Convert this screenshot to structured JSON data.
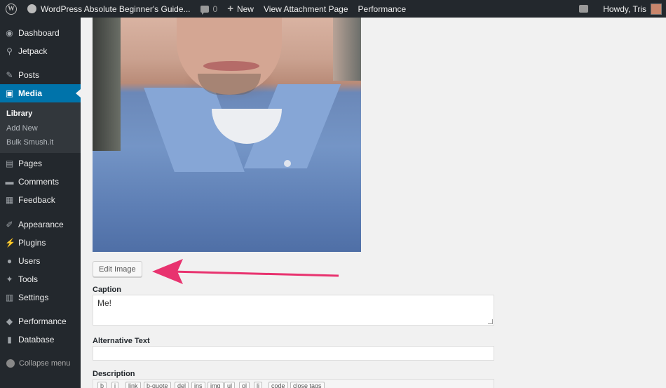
{
  "adminbar": {
    "site_title": "WordPress Absolute Beginner's Guide...",
    "comments_count": "0",
    "new_label": "New",
    "view_attachment_label": "View Attachment Page",
    "performance_label": "Performance",
    "howdy_label": "Howdy, Tris"
  },
  "menu": {
    "items": [
      {
        "label": "Dashboard",
        "icon": "dashboard-icon"
      },
      {
        "label": "Jetpack",
        "icon": "jetpack-icon"
      },
      {
        "label": "Posts",
        "icon": "pin-icon"
      },
      {
        "label": "Media",
        "icon": "media-icon"
      },
      {
        "label": "Pages",
        "icon": "page-icon"
      },
      {
        "label": "Comments",
        "icon": "comment-icon"
      },
      {
        "label": "Feedback",
        "icon": "feedback-icon"
      },
      {
        "label": "Appearance",
        "icon": "brush-icon"
      },
      {
        "label": "Plugins",
        "icon": "plugin-icon"
      },
      {
        "label": "Users",
        "icon": "users-icon"
      },
      {
        "label": "Tools",
        "icon": "wrench-icon"
      },
      {
        "label": "Settings",
        "icon": "settings-icon"
      },
      {
        "label": "Performance",
        "icon": "performance-icon"
      },
      {
        "label": "Database",
        "icon": "database-icon"
      }
    ],
    "media_submenu": [
      "Library",
      "Add New",
      "Bulk Smush.it"
    ],
    "collapse_label": "Collapse menu"
  },
  "edit_image_label": "Edit Image",
  "caption": {
    "label": "Caption",
    "value": "Me!"
  },
  "alt_text": {
    "label": "Alternative Text",
    "value": ""
  },
  "description": {
    "label": "Description",
    "quicktags": [
      "b",
      "i",
      "link",
      "b-quote",
      "del",
      "ins",
      "img",
      "ul",
      "ol",
      "li",
      "code",
      "close tags"
    ]
  },
  "colors": {
    "admin_bar": "#23282d",
    "active_menu": "#0073aa",
    "annotation_arrow": "#e8336f"
  }
}
